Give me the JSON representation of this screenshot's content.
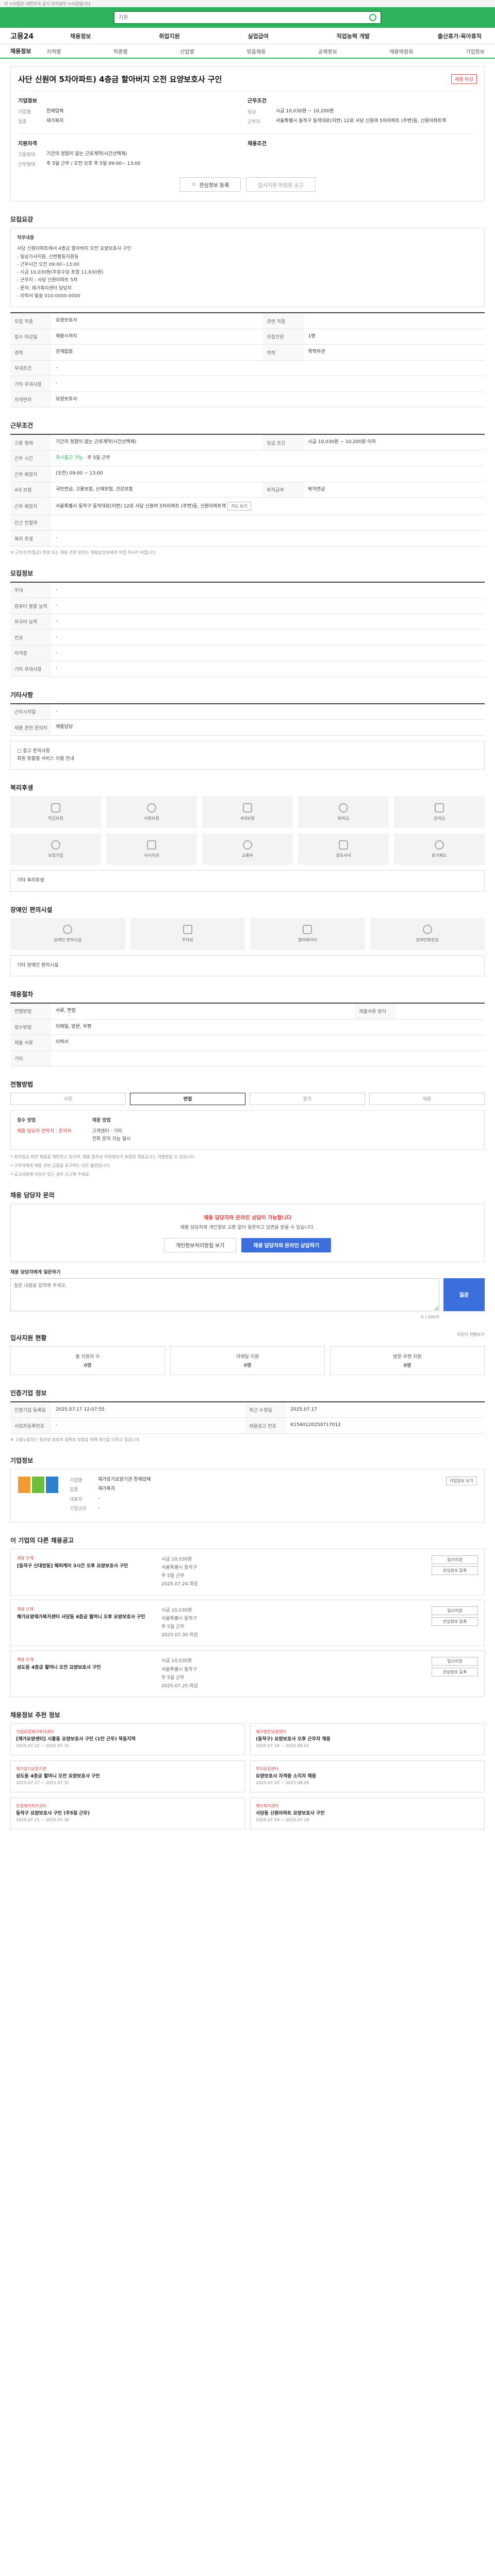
{
  "topbar": {
    "text": "이 누리집은 대한민국 공식 전자정부 누리집입니다."
  },
  "search": {
    "placeholder": "지원"
  },
  "gnb": {
    "logo": "고용24",
    "menu": [
      "채용정보",
      "취업지원",
      "실업급여",
      "직업능력 개발",
      "출산휴가·육아휴직"
    ]
  },
  "lnb": {
    "title": "채용정보",
    "tabs": [
      "지역별",
      "직종별",
      "산업별",
      "맞춤채용",
      "공채정보",
      "채용박람회",
      "기업정보"
    ]
  },
  "job": {
    "title": "사단 신원여 5차아파트) 4층금 할아버지 오전 요양보호사 구인",
    "badge": "채용 마감",
    "col1_title": "기업정보",
    "col1": [
      {
        "k": "기업명",
        "v": "한재업체"
      },
      {
        "k": "업종",
        "v": "재가복지"
      }
    ],
    "col2_title": "근무조건",
    "col2": [
      {
        "k": "임금",
        "v": "시급 10,030원 ~ 10,200원"
      },
      {
        "k": "근무지",
        "v": "서울특별시 동작구 동작대로(지번) 12로 사당 신원여 5차아파트 (주변)등, 신원아파트역"
      }
    ],
    "col3_title": "지원자격",
    "col3": [
      {
        "k": "고용형태",
        "v": "기간의 정함이 없는 근로계약(시간선택제)"
      },
      {
        "k": "근무형태",
        "v": "주 5일 근무 / 오전 오후 주 5일 09:00~ 13:00"
      }
    ],
    "col4_title": "채용조건",
    "col4": [],
    "btn_scrap": "관심정보 등록",
    "btn_apply": "입사지원 마감된 공고"
  },
  "sections": {
    "recruit_title": "모집요강",
    "recruit_box_key": "직무내용",
    "recruit_box_lines": [
      "사당 신원아파트에서 4층금 할아버지 오전 요양보호사 구인",
      "- 일상가사지원, 신변활동지원등",
      "- 근무시간 오전 09:00~13:00",
      "- 시급 10,030원(주휴수당 포함 11,630원)",
      "- 근무지 : 사당 신원아파트 5차",
      "- 문의: 재가복지센터 담당자",
      "- 이력서 발송 010-0000-0000"
    ],
    "recruit_rows": [
      {
        "k": "모집 직종",
        "v": "요양보호사",
        "k2": "관련 직종",
        "v2": ""
      },
      {
        "k": "접수 마감일",
        "v": "채용시까지",
        "k2": "모집인원",
        "v2": "1명"
      },
      {
        "k": "경력",
        "v": "관계없음",
        "k2": "학력",
        "v2": "학력무관"
      },
      {
        "k": "우대조건",
        "v": "-",
        "k2": "",
        "v2": ""
      },
      {
        "k": "기타 우대사항",
        "v": "-",
        "k2": "",
        "v2": ""
      },
      {
        "k": "자격면허",
        "v": "요양보호사",
        "k2": "",
        "v2": ""
      }
    ],
    "work_title": "근무조건",
    "work_rows": [
      {
        "k": "고용 형태",
        "v": "기간의 정함이 없는 근로계약(시간선택제)",
        "k2": "임금 조건",
        "v2": "시급 10,030원 ~ 10,200원 이하"
      },
      {
        "k": "근무 시간",
        "v": "주 5일 근무",
        "k2": "",
        "v2": ""
      },
      {
        "k": "근무 예정지",
        "v": "(오전) 09:00 ~ 13:00",
        "k2": "",
        "v2": ""
      },
      {
        "k": "4대 보험",
        "v": "국민연금, 고용보험, 산재보험, 건강보험",
        "k2": "퇴직급여",
        "v2": "퇴직연금"
      },
      {
        "k": "근무 예정지",
        "v": "서울특별시 동작구 동작대로(지번) 12로 사당 신원여 5차아파트 (주변)등, 신원아파트역",
        "k2": "",
        "v2": ""
      },
      {
        "k": "인근 전철역",
        "v": "",
        "k2": "",
        "v2": ""
      },
      {
        "k": "복리 후생",
        "v": "-",
        "k2": "",
        "v2": ""
      }
    ],
    "work_note": "※ 근로조건(임금) 변경 또는 채용 관련 문의는 채용담당자에게 직접 하시기 바랍니다.",
    "work_btn": "지도 보기",
    "work_apply": "즉시출근 가능",
    "etc_title": "모집정보",
    "etc_rows": [
      {
        "k": "우대",
        "v": "-"
      },
      {
        "k": "컴퓨터 활용 능력",
        "v": "-"
      },
      {
        "k": "외국어 능력",
        "v": "-"
      },
      {
        "k": "전공",
        "v": "-"
      },
      {
        "k": "자격증",
        "v": "-"
      },
      {
        "k": "기타 우대사항",
        "v": "-"
      }
    ],
    "apply_title": "기타사항",
    "apply_rows": [
      {
        "k": "근무시작일",
        "v": "-"
      },
      {
        "k": "채용 관련 문의처",
        "v": "채용담당"
      }
    ],
    "apply_note": "□ 참고 문의사항",
    "apply_note2": "회원 맞춤형 서비스 이용 안내",
    "welfare_title": "복리후생",
    "welfare_items": [
      "연금보험",
      "사회보험",
      "4대보험",
      "퇴직금",
      "상여금",
      "보험가입",
      "식사지원",
      "교통비",
      "경조사비",
      "휴가제도"
    ],
    "welfare_note": "기타 복리후생",
    "disabled_title": "장애인 편의시설",
    "disabled_items": [
      "장애인 편의시설",
      "주차장",
      "엘리베이터",
      "장애인화장실"
    ],
    "disabled_note": "기타 장애인 편의시설",
    "process_title": "채용절차",
    "process_rows": [
      {
        "k": "전형방법",
        "v": "서류, 면접",
        "k2": "제출서류 양식",
        "v2": ""
      },
      {
        "k": "접수방법",
        "v": "이메일, 방문, 우편",
        "k2": "",
        "v2": ""
      },
      {
        "k": "제출 서류",
        "v": "이력서",
        "k2": "",
        "v2": ""
      },
      {
        "k": "기타",
        "v": "",
        "k2": "",
        "v2": ""
      }
    ],
    "flow_title": "전형방법",
    "flow_steps": [
      "서류",
      "면접",
      "합격",
      "채용"
    ],
    "contact_k1": "접수 방법",
    "contact_v1": "채용 담당자 연락처 : 문의처",
    "contact_k2": "채용 방법",
    "contact_v2": "고객센터 · 기타",
    "contact_v3": "전화 문의 가능 일시",
    "caution_lines": [
      "• 최저임금 미만 채용을 제한하고 있으며, 채용 절차상 허위정보가 포함된 채용공고는 처벌받을 수 있습니다.",
      "• 구직자에게 채용 관련 금품을 요구하는 것은 불법입니다.",
      "• 공고내용에 이상이 있는 경우 신고해 주세요."
    ],
    "consult_title": "채용 담당자 문의",
    "consult_badge": "채용 담당자와 온라인 상담이 가능합니다",
    "consult_msg": "채용 담당자와 개인정보 교환 없이 질문하고 답변을 받을 수 있습니다.",
    "consult_btn1": "개인정보처리방침 보기",
    "consult_btn2": "채용 담당자와 온라인 상담하기",
    "qa_title": "채용 담당자에게 질문하기",
    "qa_placeholder": "질문 내용을 입력해 주세요.",
    "qa_submit": "질문",
    "qa_count": "0 / 500자",
    "stats_title": "입사지원 현황",
    "stats_link": "지원자 현황보기",
    "stats": [
      {
        "label": "총 지원자 수",
        "value": "0명"
      },
      {
        "label": "이메일 지원",
        "value": "0명"
      },
      {
        "label": "방문·우편 지원",
        "value": "0명"
      }
    ],
    "info_title": "인증기업 정보",
    "info_rows": [
      {
        "k": "인증기업 등록일",
        "v": "2025.07.17 12:07:55",
        "k2": "최근 수정일",
        "v2": "2025.07.17"
      },
      {
        "k": "사업자등록번호",
        "v": "-",
        "k2": "채용공고 번호",
        "v2": "K1540120250717012"
      }
    ],
    "info_note": "※ 고용노동부는 워크넷 정보의 정확성 보장을 위해 최선을 다하고 있습니다.",
    "company_title": "기업정보",
    "company_rows": [
      {
        "k": "기업명",
        "v": "재가장기요양기관 한재업체"
      },
      {
        "k": "업종",
        "v": "재가복지"
      },
      {
        "k": "대표자",
        "v": "-"
      },
      {
        "k": "기업규모",
        "v": "-"
      }
    ],
    "company_btn": "기업정보 보기",
    "similar_title": "이 기업의 다른 채용공고",
    "similar": [
      {
        "co": "채용 단계",
        "title": "[동작구 신대방동] 해피케어 3시간 오후 요양보호사 구인",
        "d1": "시급 10,030원",
        "d2": "서울특별시 동작구",
        "d3": "주 5일 근무",
        "d4": "2025.07.24 마감",
        "b1": "입사지원",
        "b2": "관심정보 등록"
      },
      {
        "co": "채용 단계",
        "title": "해가요양재가복지센터 사당동 4층금 할머니 오후 요양보호사 구인",
        "d1": "시급 10,030원",
        "d2": "서울특별시 동작구",
        "d3": "주 5일 근무",
        "d4": "2025.07.30 마감",
        "b1": "입사지원",
        "b2": "관심정보 등록"
      },
      {
        "co": "채용 단계",
        "title": "삼도동 4층금 할머니 오전 요양보호사 구인",
        "d1": "시급 10,030원",
        "d2": "서울특별시 동작구",
        "d3": "주 5일 근무",
        "d4": "2025.07.25 마감",
        "b1": "입사지원",
        "b2": "관심정보 등록"
      }
    ],
    "rec_title": "채용정보 추천 정보",
    "rec": [
      {
        "co": "기업요양재가복지센터",
        "t": "[재가요양센터] 시흥동 요양보호사 구인 (1인 근무) 목동지역",
        "d": "2025.07.22 ~ 2025.07.31"
      },
      {
        "co": "재가방문요양센터",
        "t": "(동작구) 요양보호사 오후 근무자 채용",
        "d": "2025.07.18 ~ 2025.08.01"
      },
      {
        "co": "재가장기요양기관",
        "t": "삼도동 4층금 할머니 오전 요양보호사 구인",
        "d": "2025.07.17 ~ 2025.07.31"
      },
      {
        "co": "복지요양센터",
        "t": "요양보호사 자격증 소지자 채용",
        "d": "2025.07.20 ~ 2025.08.05"
      },
      {
        "co": "요양재가복지센터",
        "t": "동작구 요양보호사 구인 (주5일 근무)",
        "d": "2025.07.21 ~ 2025.07.30"
      },
      {
        "co": "재가복지센터",
        "t": "사당동 신원아파트 요양보호사 구인",
        "d": "2025.07.19 ~ 2025.07.29"
      }
    ]
  },
  "colors": {
    "brand": "#2db45d",
    "accent": "#3a6fdc",
    "alert": "#e03d3d"
  }
}
